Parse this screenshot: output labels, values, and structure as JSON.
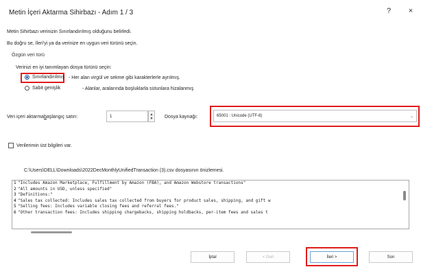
{
  "window": {
    "title": "Metin İçeri Aktarma Sihirbazı - Adım 1 / 3",
    "help_label": "?",
    "close_label": "×"
  },
  "intro": {
    "line1": "Metin Sihirbazı verinizin Sınırlandırılmış olduğunu belirledi.",
    "line2": "Bu doğru se, İleri'yi ya da verinize en uygun veri türünü seçin."
  },
  "data_type_group": {
    "label": "Özgün veri türü",
    "prompt": "Verinizi en iyi tanımlayan dosya türünü seçin:",
    "options": [
      {
        "label": "Sınırlandırılmış",
        "description": "- Her alan virgül ve sekme gibi karakterlerle ayrılmış.",
        "selected": true
      },
      {
        "label": "Sabit genişlik",
        "description": "- Alanlar, aralarında boşluklarla sütunlara hizalanmış",
        "selected": false
      }
    ]
  },
  "start_row": {
    "label_pre": "Veri içeri aktarma",
    "label_u": "b",
    "label_post": "aşlangıç satırı:",
    "value": "1"
  },
  "file_origin": {
    "label": "Dosya kaynağı:",
    "value": "65001 : Unicode (UTF-8)"
  },
  "headers_checkbox": {
    "label": "Verilerimin üst bilgileri var.",
    "checked": false
  },
  "preview": {
    "caption": "C:\\Users\\DELL\\Downloads\\2022DecMonthlyUnifiedTransaction (3).csv dosyasının önizlemesi.",
    "rows": [
      {
        "n": "1",
        "text": "\"Includes Amazon Marketplace, Fulfillment by Amazon (FBA), and Amazon Webstore transactions\""
      },
      {
        "n": "2",
        "text": "\"All amounts in USD, unless specified\""
      },
      {
        "n": "3",
        "text": "\"Definitions:\""
      },
      {
        "n": "4",
        "text": "\"Sales tax collected: Includes sales tax collected from buyers for product sales, shipping, and gift w"
      },
      {
        "n": "5",
        "text": "\"Selling fees: Includes variable closing fees and referral fees.\""
      },
      {
        "n": "6",
        "text": "\"Other transaction fees: Includes shipping chargebacks, shipping holdbacks, per-item fees  and sales t"
      }
    ]
  },
  "buttons": {
    "cancel": "İptal",
    "back": "< Geri",
    "next": "İleri >",
    "finish": "Son"
  },
  "colors": {
    "highlight": "#e01b1b",
    "accent": "#1a4fa0"
  }
}
